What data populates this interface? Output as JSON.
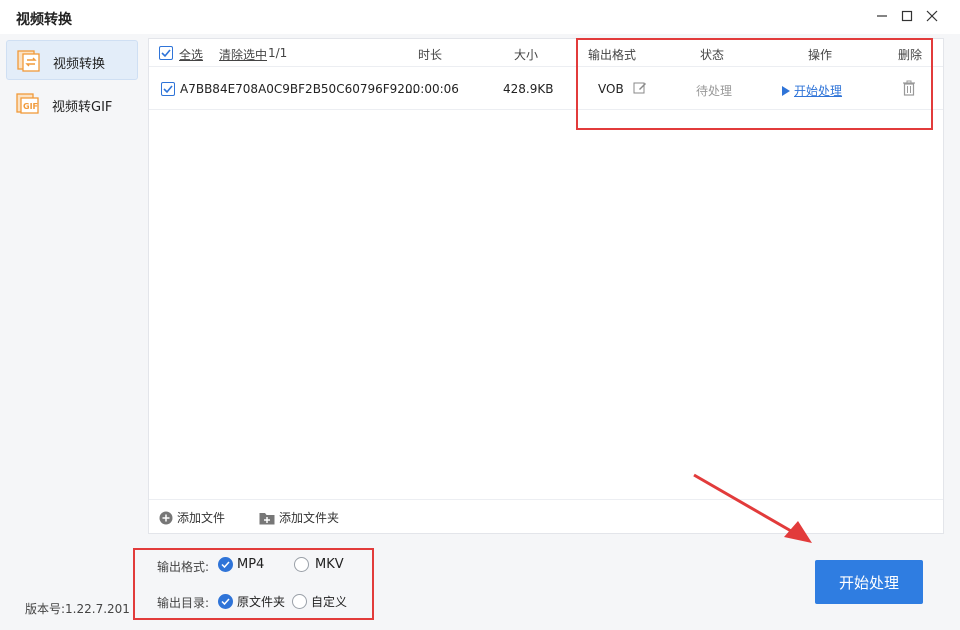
{
  "app": {
    "title": "视频转换"
  },
  "sidebar": {
    "items": [
      {
        "label": "视频转换",
        "active": true,
        "icon": "video-convert-icon"
      },
      {
        "label": "视频转GIF",
        "active": false,
        "icon": "gif-icon"
      }
    ],
    "version": "版本号:1.22.7.201"
  },
  "table": {
    "select_all": "全选",
    "clear_selected": "清除选中",
    "count": "1/1",
    "headers": {
      "duration": "时长",
      "size": "大小",
      "output_format": "输出格式",
      "status": "状态",
      "action": "操作",
      "delete": "删除"
    },
    "rows": [
      {
        "checked": true,
        "name": "A7BB84E708A0C9BF2B50C60796F92...",
        "duration": "00:00:06",
        "size": "428.9KB",
        "format": "VOB",
        "status": "待处理",
        "action": "开始处理"
      }
    ]
  },
  "footer": {
    "add_file": "添加文件",
    "add_folder": "添加文件夹"
  },
  "settings": {
    "format_label": "输出格式:",
    "format_options": [
      "MP4",
      "MKV"
    ],
    "format_selected": "MP4",
    "dir_label": "输出目录:",
    "dir_options": [
      "原文件夹",
      "自定义"
    ],
    "dir_selected": "原文件夹"
  },
  "start_button": "开始处理",
  "colors": {
    "accent": "#2f7de1",
    "highlight_box": "#e23b3b",
    "arrow": "#e23b3b"
  }
}
